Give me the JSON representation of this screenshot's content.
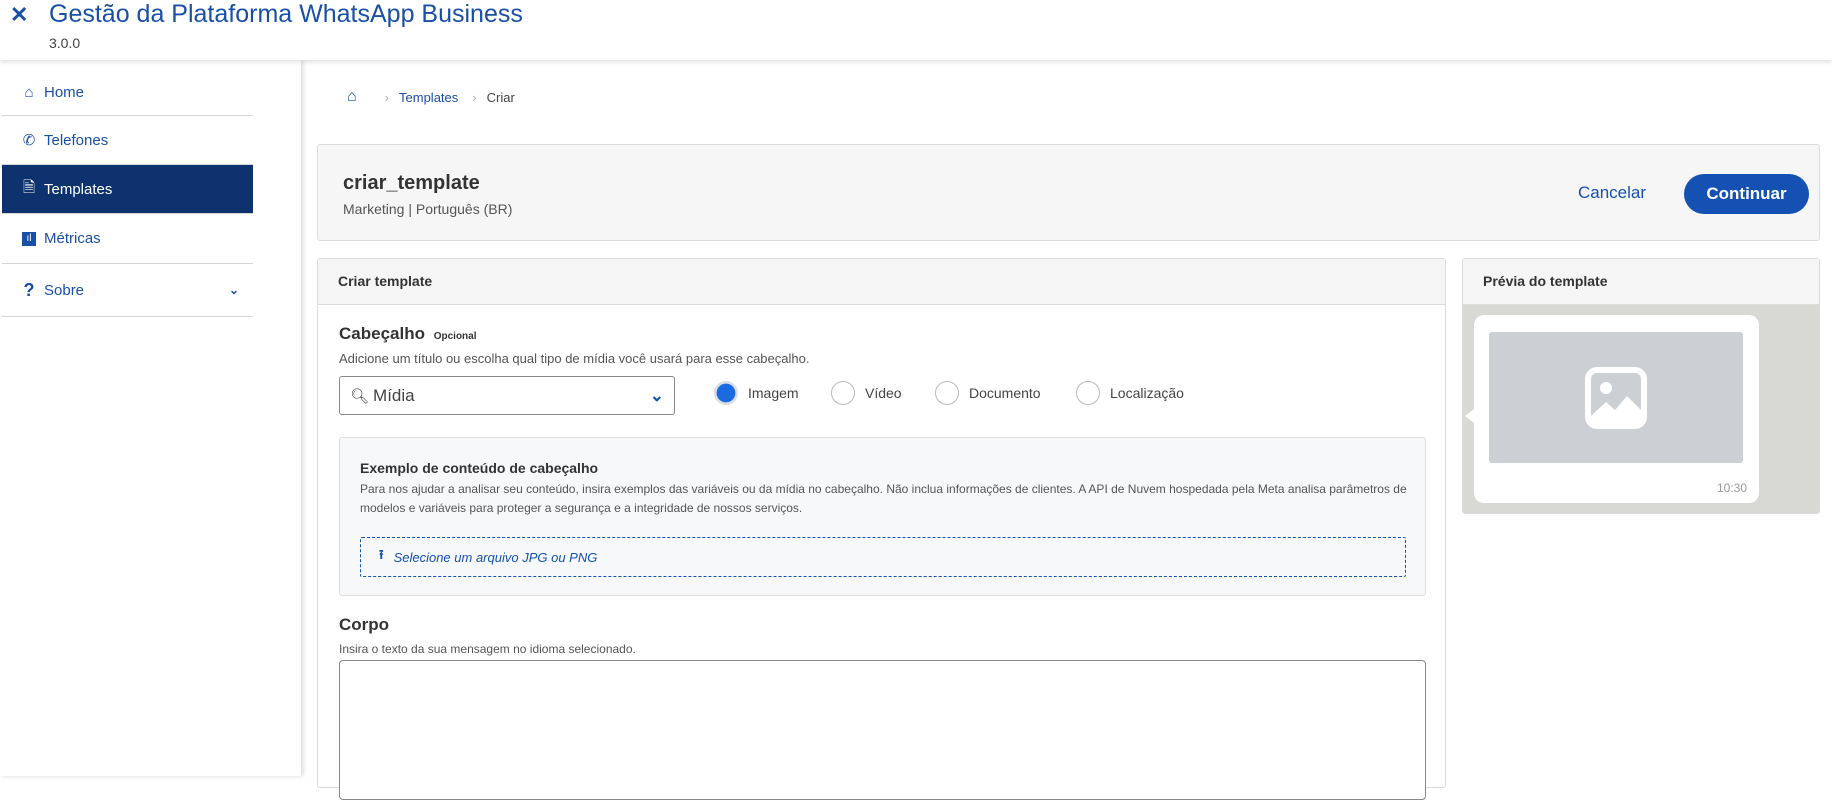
{
  "header": {
    "title": "Gestão da Plataforma WhatsApp Business",
    "version": "3.0.0"
  },
  "sidebar": {
    "items": [
      {
        "label": "Home",
        "icon": "home-icon"
      },
      {
        "label": "Telefones",
        "icon": "phone-icon"
      },
      {
        "label": "Templates",
        "icon": "file-code-icon",
        "active": true
      },
      {
        "label": "Métricas",
        "icon": "chart-icon"
      },
      {
        "label": "Sobre",
        "icon": "question-icon"
      }
    ]
  },
  "breadcrumb": {
    "items": [
      "Templates",
      "Criar"
    ]
  },
  "template": {
    "name": "criar_template",
    "meta": "Marketing | Português (BR)",
    "cancel": "Cancelar",
    "continue": "Continuar"
  },
  "form": {
    "title": "Criar template",
    "header_label": "Cabeçalho",
    "optional": "Opcional",
    "header_desc": "Adicione um título ou escolha qual tipo de mídia você usará para esse cabeçalho.",
    "select_value": "Mídia",
    "radios": [
      {
        "label": "Imagem",
        "checked": true
      },
      {
        "label": "Vídeo"
      },
      {
        "label": "Documento"
      },
      {
        "label": "Localização"
      }
    ],
    "example_title": "Exemplo de conteúdo de cabeçalho",
    "example_desc": "Para nos ajudar a analisar seu conteúdo, insira exemplos das variáveis ou da mídia no cabeçalho. Não inclua informações de clientes. A API de Nuvem hospedada pela Meta analisa parâmetros de modelos e variáveis para proteger a segurança e a integridade de nossos serviços.",
    "upload": "Selecione um arquivo JPG ou PNG",
    "body_label": "Corpo",
    "body_desc": "Insira o texto da sua mensagem no idioma selecionado.",
    "body_value": ""
  },
  "preview": {
    "title": "Prévia do template",
    "time": "10:30"
  },
  "colors": {
    "accent": "#1451b3",
    "sidebar_active": "#0d326e"
  }
}
